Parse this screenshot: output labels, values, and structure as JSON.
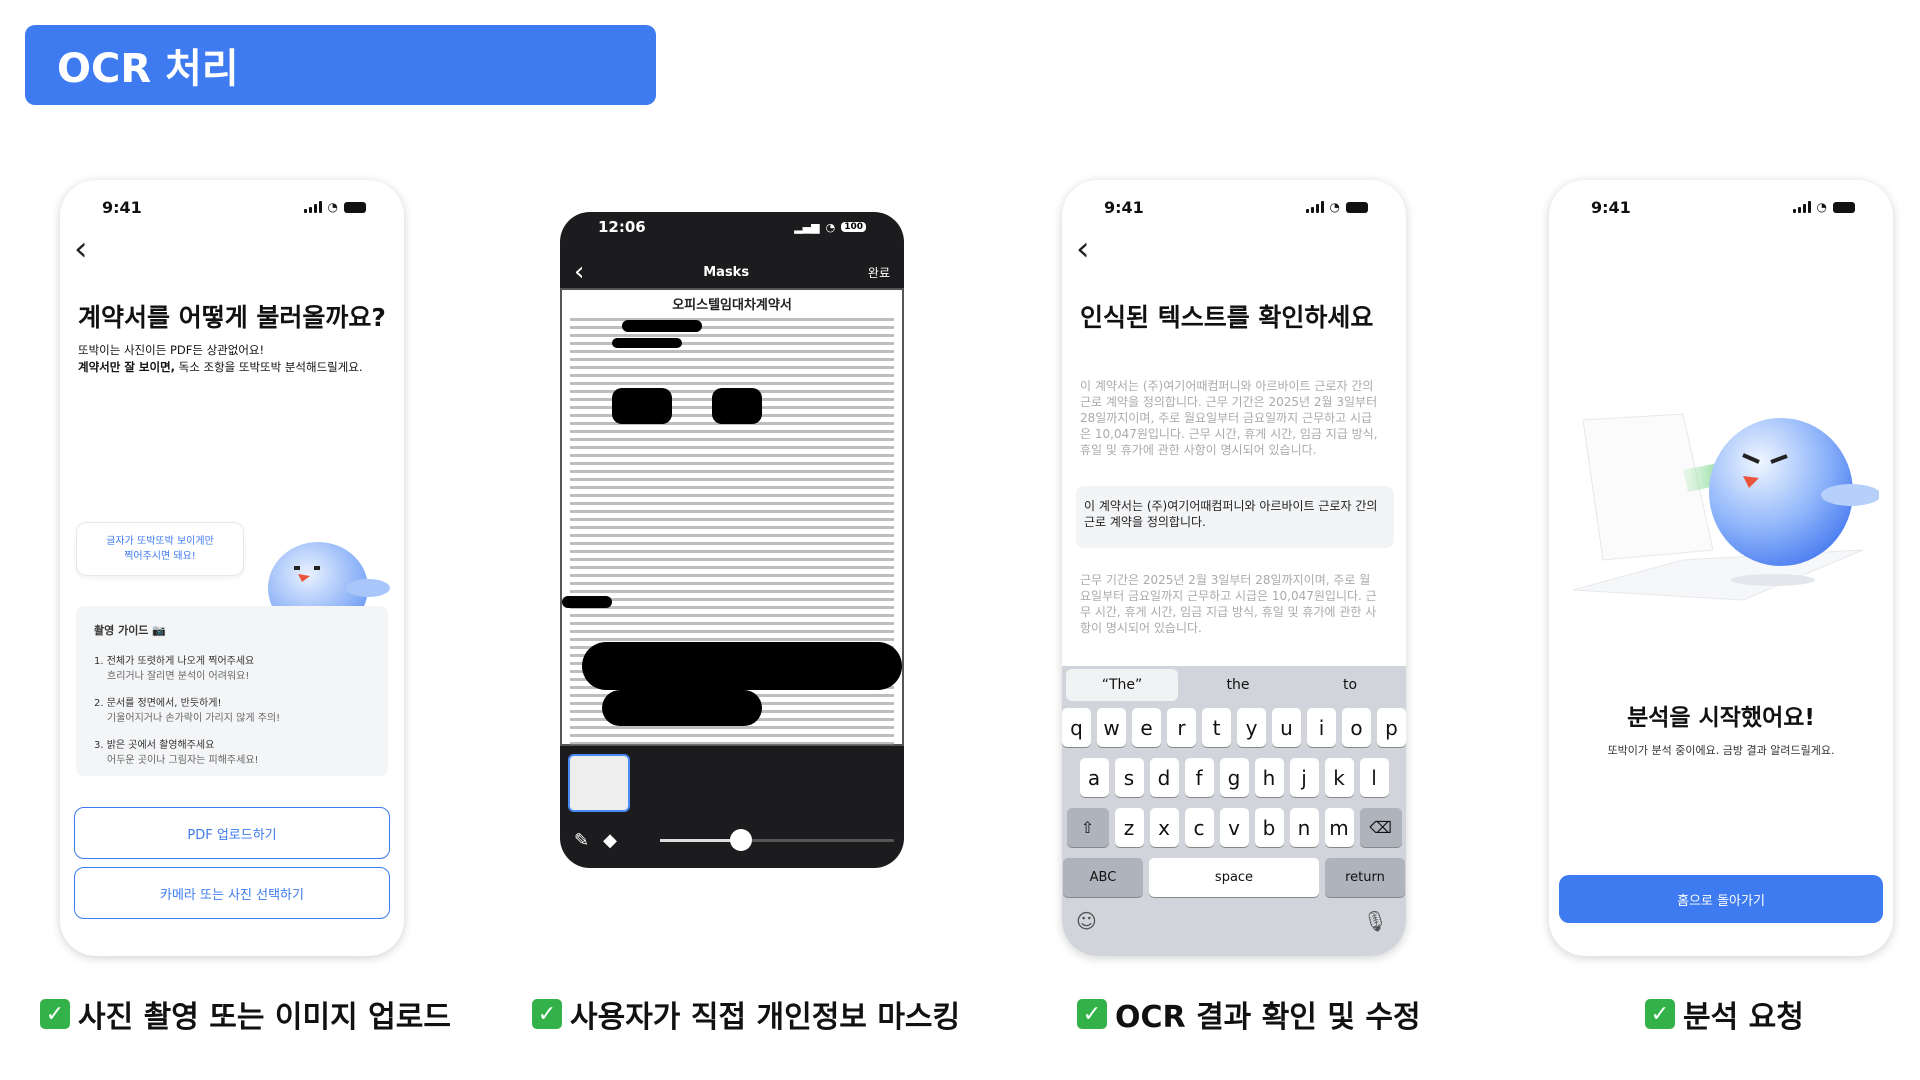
{
  "header": {
    "title": "OCR 처리"
  },
  "status_time": "9:41",
  "screen1": {
    "title": "계약서를 어떻게 불러올까요?",
    "sub1": "또박이는 사진이든 PDF든 상관없어요!",
    "sub2_bold": "계약서만 잘 보이면,",
    "sub2_rest": " 독소 조항을 또박또박 분석해드릴게요.",
    "bubble_l1": "글자가 또박또박 보이게만",
    "bubble_l2": "찍어주시면 돼요!",
    "guide_title": "촬영 가이드 📷",
    "guide_items": [
      {
        "main": "1. 전체가 또렷하게 나오게 찍어주세요",
        "sub": "흐리거나 잘리면 분석이 어려워요!"
      },
      {
        "main": "2. 문서를 정면에서, 반듯하게!",
        "sub": "기울어지거나 손가락이 가리지 않게 주의!"
      },
      {
        "main": "3. 밝은 곳에서 촬영해주세요",
        "sub": "어두운 곳이나 그림자는 피해주세요!"
      }
    ],
    "btn_pdf": "PDF 업로드하기",
    "btn_camera": "카메라 또는 사진 선택하기"
  },
  "screen2": {
    "time": "12:06",
    "battery": "100",
    "nav_title": "Masks",
    "done": "완료",
    "doc_title": "오피스텔임대차계약서"
  },
  "screen3": {
    "title": "인식된 텍스트를 확인하세요",
    "para1": "이 계약서는 (주)여기어때컴퍼니와 아르바이트 근로자 간의 근로 계약을 정의합니다. 근무 기간은 2025년 2월 3일부터 28일까지이며, 주로 월요일부터 금요일까지 근무하고 시급은 10,047원입니다. 근무 시간, 휴게 시간, 임금 지급 방식, 휴일 및 휴가에 관한 사항이 명시되어 있습니다.",
    "highlight": "이 계약서는 (주)여기어때컴퍼니와 아르바이트 근로자 간의 근로 계약을 정의합니다.",
    "para2": "근무 기간은 2025년 2월 3일부터 28일까지이며, 주로 월요일부터 금요일까지 근무하고 시급은 10,047원입니다. 근무 시간, 휴게 시간, 임금 지급 방식, 휴일 및 휴가에 관한 사항이 명시되어 있습니다.",
    "suggestions": [
      "“The”",
      "the",
      "to"
    ],
    "row1": [
      "q",
      "w",
      "e",
      "r",
      "t",
      "y",
      "u",
      "i",
      "o",
      "p"
    ],
    "row2": [
      "a",
      "s",
      "d",
      "f",
      "g",
      "h",
      "j",
      "k",
      "l"
    ],
    "row3": [
      "z",
      "x",
      "c",
      "v",
      "b",
      "n",
      "m"
    ],
    "abc": "ABC",
    "space": "space",
    "return": "return"
  },
  "screen4": {
    "title": "분석을 시작했어요!",
    "sub": "또박이가 분석 중이에요. 금방 결과 알려드릴게요.",
    "btn_home": "홈으로 돌아가기"
  },
  "captions": [
    "사진 촬영 또는 이미지 업로드",
    "사용자가 직접 개인정보 마스킹",
    "OCR 결과 확인 및 수정",
    "분석 요청"
  ],
  "colors": {
    "accent": "#3e7bf0",
    "check": "#33b249"
  }
}
